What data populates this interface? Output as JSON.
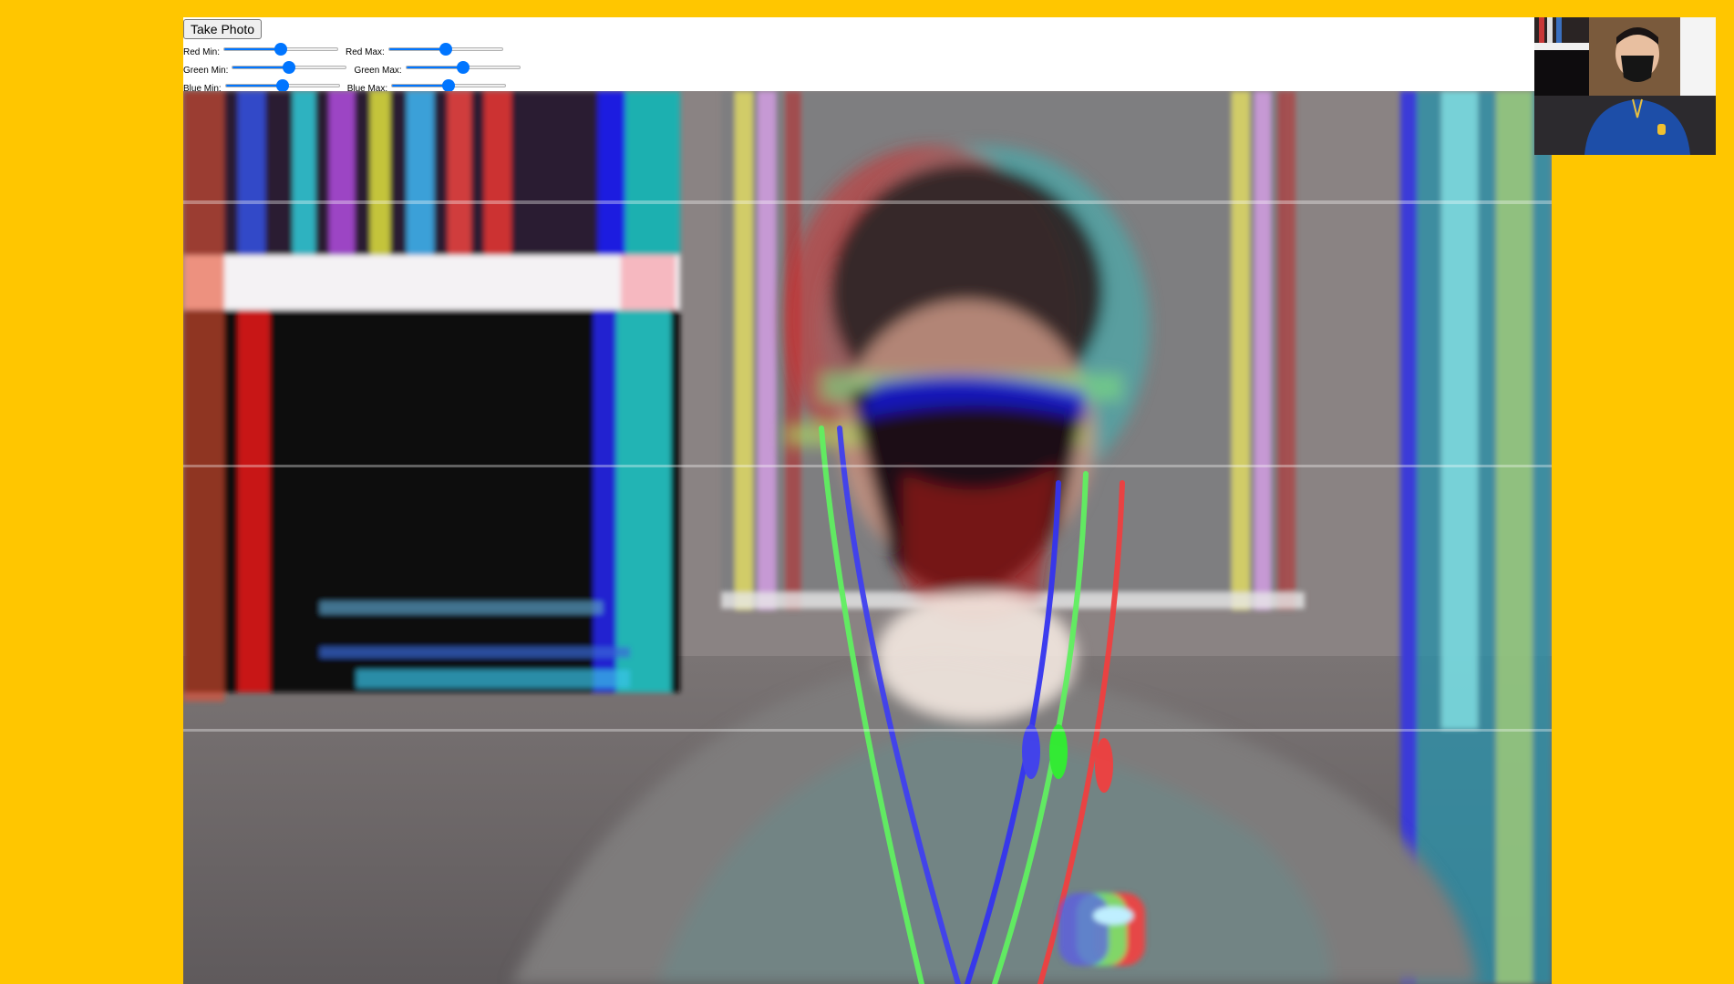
{
  "controls": {
    "take_photo_label": "Take Photo",
    "sliders": {
      "red_min": {
        "label": "Red Min:",
        "value": 0.5
      },
      "red_max": {
        "label": "Red Max:",
        "value": 0.5
      },
      "green_min": {
        "label": "Green Min:",
        "value": 0.5
      },
      "green_max": {
        "label": "Green Max:",
        "value": 0.5
      },
      "blue_min": {
        "label": "Blue Min:",
        "value": 0.5
      },
      "blue_max": {
        "label": "Blue Max:",
        "value": 0.5
      }
    }
  },
  "colors": {
    "background": "#ffc600",
    "panel": "#ffffff",
    "slider_accent": "#0075ff"
  }
}
